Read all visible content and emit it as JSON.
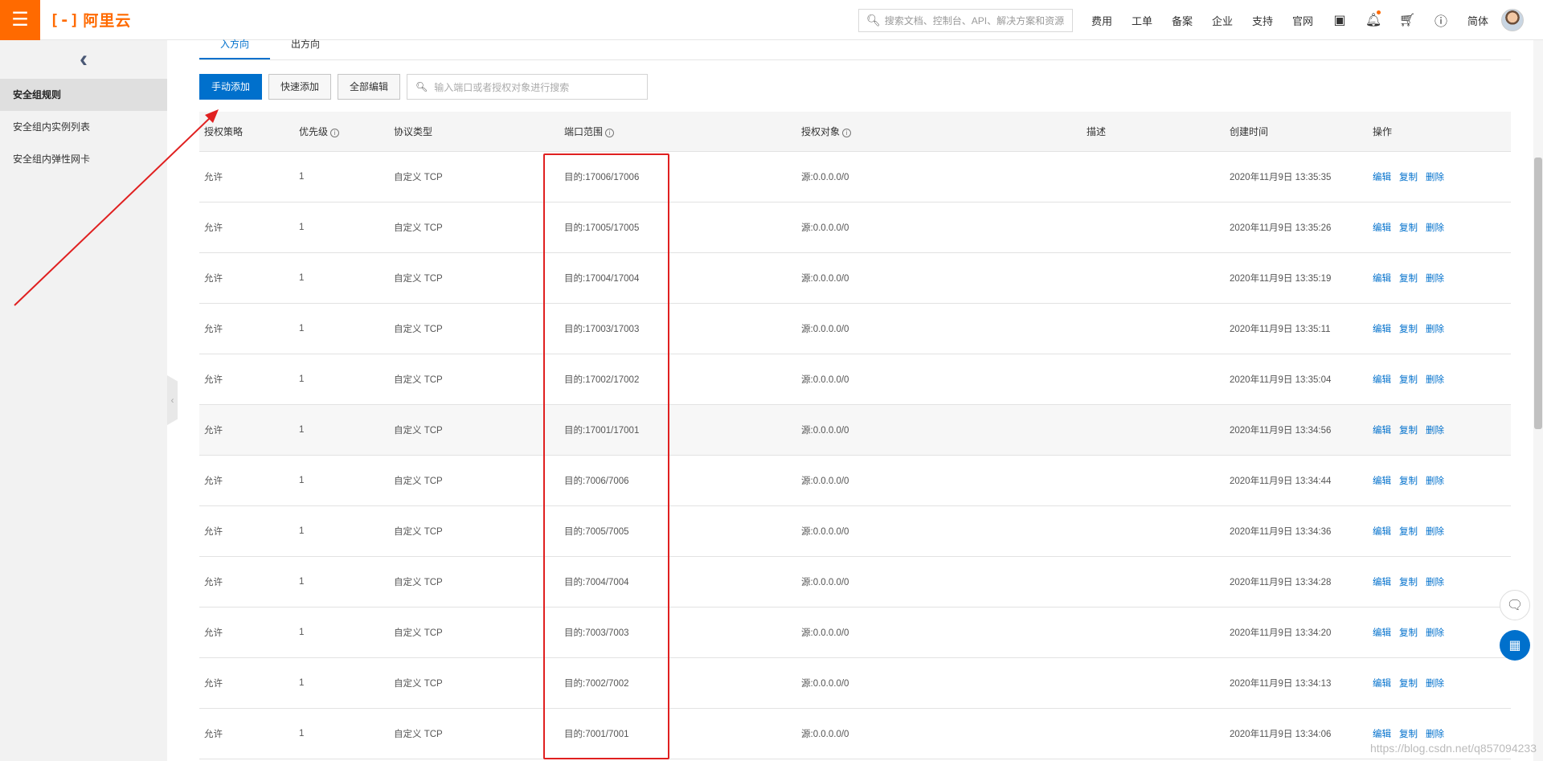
{
  "header": {
    "menu_icon": "hamburger-icon",
    "logo_mark": "[-]",
    "logo_text": "阿里云",
    "search_placeholder": "搜索文档、控制台、API、解决方案和资源",
    "nav": [
      "费用",
      "工单",
      "备案",
      "企业",
      "支持",
      "官网"
    ],
    "icons": [
      "terminal-icon",
      "bell-icon",
      "cart-icon",
      "help-icon"
    ],
    "lang": "简体",
    "accent": "#ff6a00"
  },
  "sidebar": {
    "back_icon": "‹",
    "items": [
      {
        "label": "安全组规则",
        "active": true
      },
      {
        "label": "安全组内实例列表",
        "active": false
      },
      {
        "label": "安全组内弹性网卡",
        "active": false
      }
    ]
  },
  "tabs": [
    {
      "label": "入方向",
      "active": true
    },
    {
      "label": "出方向",
      "active": false
    }
  ],
  "toolbar": {
    "manual_add": "手动添加",
    "quick_add": "快速添加",
    "edit_all": "全部编辑",
    "search_placeholder": "输入端口或者授权对象进行搜索"
  },
  "table": {
    "headers": [
      "授权策略",
      "优先级",
      "协议类型",
      "端口范围",
      "授权对象",
      "描述",
      "创建时间",
      "操作"
    ],
    "actions": [
      "编辑",
      "复制",
      "删除"
    ],
    "rows": [
      {
        "policy": "允许",
        "priority": "1",
        "protocol": "自定义 TCP",
        "port": "目的:17006/17006",
        "source": "源:0.0.0.0/0",
        "desc": "",
        "created": "2020年11月9日 13:35:35"
      },
      {
        "policy": "允许",
        "priority": "1",
        "protocol": "自定义 TCP",
        "port": "目的:17005/17005",
        "source": "源:0.0.0.0/0",
        "desc": "",
        "created": "2020年11月9日 13:35:26"
      },
      {
        "policy": "允许",
        "priority": "1",
        "protocol": "自定义 TCP",
        "port": "目的:17004/17004",
        "source": "源:0.0.0.0/0",
        "desc": "",
        "created": "2020年11月9日 13:35:19"
      },
      {
        "policy": "允许",
        "priority": "1",
        "protocol": "自定义 TCP",
        "port": "目的:17003/17003",
        "source": "源:0.0.0.0/0",
        "desc": "",
        "created": "2020年11月9日 13:35:11"
      },
      {
        "policy": "允许",
        "priority": "1",
        "protocol": "自定义 TCP",
        "port": "目的:17002/17002",
        "source": "源:0.0.0.0/0",
        "desc": "",
        "created": "2020年11月9日 13:35:04"
      },
      {
        "policy": "允许",
        "priority": "1",
        "protocol": "自定义 TCP",
        "port": "目的:17001/17001",
        "source": "源:0.0.0.0/0",
        "desc": "",
        "created": "2020年11月9日 13:34:56"
      },
      {
        "policy": "允许",
        "priority": "1",
        "protocol": "自定义 TCP",
        "port": "目的:7006/7006",
        "source": "源:0.0.0.0/0",
        "desc": "",
        "created": "2020年11月9日 13:34:44"
      },
      {
        "policy": "允许",
        "priority": "1",
        "protocol": "自定义 TCP",
        "port": "目的:7005/7005",
        "source": "源:0.0.0.0/0",
        "desc": "",
        "created": "2020年11月9日 13:34:36"
      },
      {
        "policy": "允许",
        "priority": "1",
        "protocol": "自定义 TCP",
        "port": "目的:7004/7004",
        "source": "源:0.0.0.0/0",
        "desc": "",
        "created": "2020年11月9日 13:34:28"
      },
      {
        "policy": "允许",
        "priority": "1",
        "protocol": "自定义 TCP",
        "port": "目的:7003/7003",
        "source": "源:0.0.0.0/0",
        "desc": "",
        "created": "2020年11月9日 13:34:20"
      },
      {
        "policy": "允许",
        "priority": "1",
        "protocol": "自定义 TCP",
        "port": "目的:7002/7002",
        "source": "源:0.0.0.0/0",
        "desc": "",
        "created": "2020年11月9日 13:34:13"
      },
      {
        "policy": "允许",
        "priority": "1",
        "protocol": "自定义 TCP",
        "port": "目的:7001/7001",
        "source": "源:0.0.0.0/0",
        "desc": "",
        "created": "2020年11月9日 13:34:06"
      }
    ]
  },
  "watermark": "https://blog.csdn.net/q857094233"
}
